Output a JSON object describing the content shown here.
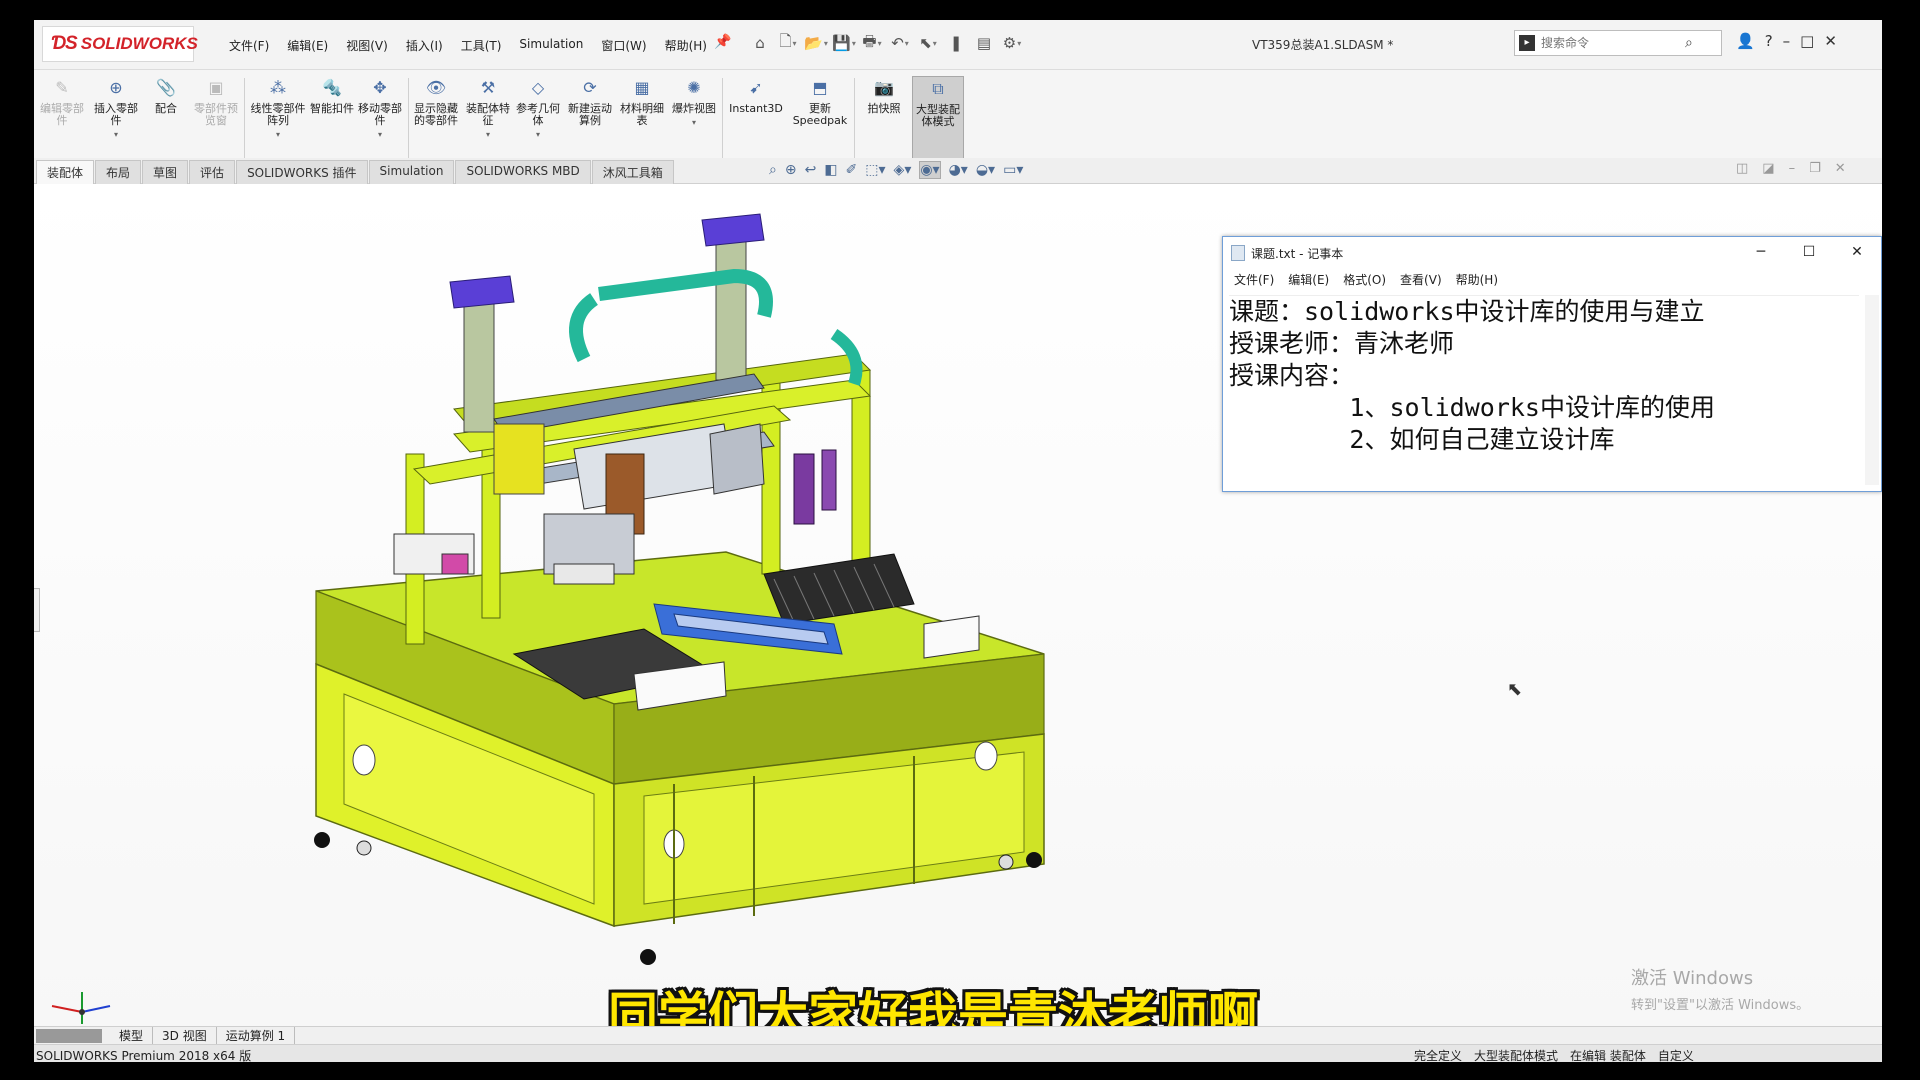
{
  "app": {
    "logo_text": "SOLIDWORKS",
    "doc_title": "VT359总装A1.SLDASM *",
    "menu": [
      "文件(F)",
      "编辑(E)",
      "视图(V)",
      "插入(I)",
      "工具(T)",
      "Simulation",
      "窗口(W)",
      "帮助(H)"
    ],
    "search_placeholder": "搜索命令"
  },
  "ribbon": {
    "buttons": [
      {
        "label": "编辑零部件",
        "icon": "edit-component-icon",
        "enabled": false
      },
      {
        "label": "插入零部件",
        "icon": "insert-component-icon",
        "enabled": true
      },
      {
        "label": "配合",
        "icon": "mate-icon",
        "enabled": true
      },
      {
        "label": "零部件预览窗",
        "icon": "component-preview-icon",
        "enabled": false
      },
      {
        "label": "线性零部件阵列",
        "icon": "linear-pattern-icon",
        "enabled": true
      },
      {
        "label": "智能扣件",
        "icon": "smart-fasteners-icon",
        "enabled": true
      },
      {
        "label": "移动零部件",
        "icon": "move-component-icon",
        "enabled": true
      },
      {
        "label": "显示隐藏的零部件",
        "icon": "show-hidden-icon",
        "enabled": true
      },
      {
        "label": "装配体特征",
        "icon": "assembly-features-icon",
        "enabled": true
      },
      {
        "label": "参考几何体",
        "icon": "reference-geometry-icon",
        "enabled": true
      },
      {
        "label": "新建运动算例",
        "icon": "new-motion-study-icon",
        "enabled": true
      },
      {
        "label": "材料明细表",
        "icon": "bom-icon",
        "enabled": true
      },
      {
        "label": "爆炸视图",
        "icon": "exploded-view-icon",
        "enabled": true
      },
      {
        "label": "Instant3D",
        "icon": "instant3d-icon",
        "enabled": true
      },
      {
        "label": "更新Speedpak",
        "icon": "speedpak-icon",
        "enabled": true
      },
      {
        "label": "拍快照",
        "icon": "snapshot-icon",
        "enabled": true
      },
      {
        "label": "大型装配体模式",
        "icon": "large-assembly-icon",
        "enabled": true
      }
    ]
  },
  "tabs": [
    "装配体",
    "布局",
    "草图",
    "评估",
    "SOLIDWORKS 插件",
    "Simulation",
    "SOLIDWORKS MBD",
    "沐风工具箱"
  ],
  "notepad": {
    "title": "课题.txt - 记事本",
    "menu": [
      "文件(F)",
      "编辑(E)",
      "格式(O)",
      "查看(V)",
      "帮助(H)"
    ],
    "lines": [
      "课题：solidworks中设计库的使用与建立",
      "授课老师：青沐老师",
      "授课内容：",
      "        1、solidworks中设计库的使用",
      "        2、如何自己建立设计库"
    ]
  },
  "subtitle": "同学们大家好我是青沐老师啊",
  "watermark": {
    "line1": "激活 Windows",
    "line2": "转到\"设置\"以激活 Windows。"
  },
  "bottom_tabs": [
    "模型",
    "3D 视图",
    "运动算例 1"
  ],
  "status": {
    "left": "SOLIDWORKS Premium 2018 x64 版",
    "right": [
      "完全定义",
      "大型装配体模式",
      "在编辑 装配体",
      "自定义"
    ]
  },
  "colors": {
    "frame_yellow": "#d8f020",
    "accent_purple": "#5a3fd6",
    "accent_teal": "#24b89a",
    "subtitle": "#ffe600"
  }
}
